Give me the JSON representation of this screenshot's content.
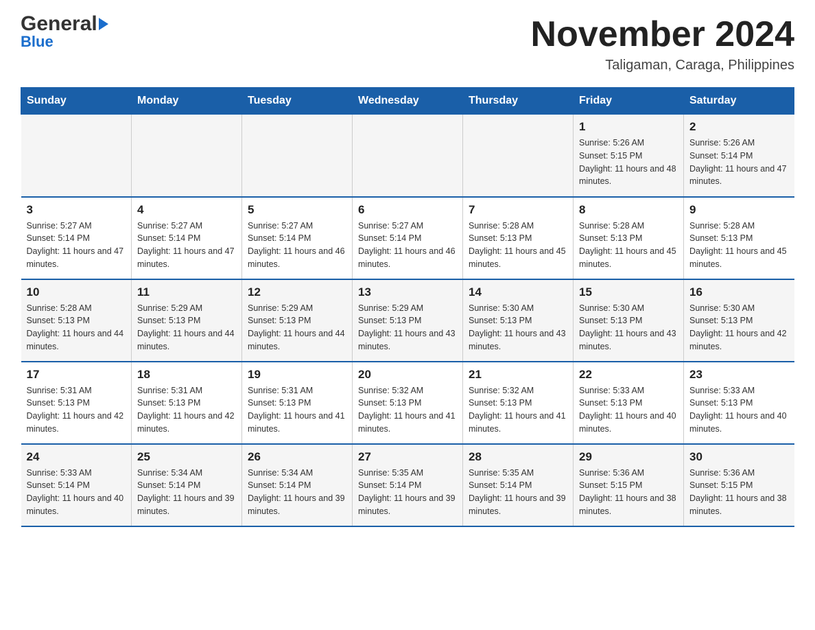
{
  "logo": {
    "general": "General",
    "blue": "Blue",
    "alt": "GeneralBlue logo"
  },
  "title": {
    "month": "November 2024",
    "location": "Taligaman, Caraga, Philippines"
  },
  "headers": [
    "Sunday",
    "Monday",
    "Tuesday",
    "Wednesday",
    "Thursday",
    "Friday",
    "Saturday"
  ],
  "weeks": [
    [
      {
        "day": "",
        "info": ""
      },
      {
        "day": "",
        "info": ""
      },
      {
        "day": "",
        "info": ""
      },
      {
        "day": "",
        "info": ""
      },
      {
        "day": "",
        "info": ""
      },
      {
        "day": "1",
        "info": "Sunrise: 5:26 AM\nSunset: 5:15 PM\nDaylight: 11 hours and 48 minutes."
      },
      {
        "day": "2",
        "info": "Sunrise: 5:26 AM\nSunset: 5:14 PM\nDaylight: 11 hours and 47 minutes."
      }
    ],
    [
      {
        "day": "3",
        "info": "Sunrise: 5:27 AM\nSunset: 5:14 PM\nDaylight: 11 hours and 47 minutes."
      },
      {
        "day": "4",
        "info": "Sunrise: 5:27 AM\nSunset: 5:14 PM\nDaylight: 11 hours and 47 minutes."
      },
      {
        "day": "5",
        "info": "Sunrise: 5:27 AM\nSunset: 5:14 PM\nDaylight: 11 hours and 46 minutes."
      },
      {
        "day": "6",
        "info": "Sunrise: 5:27 AM\nSunset: 5:14 PM\nDaylight: 11 hours and 46 minutes."
      },
      {
        "day": "7",
        "info": "Sunrise: 5:28 AM\nSunset: 5:13 PM\nDaylight: 11 hours and 45 minutes."
      },
      {
        "day": "8",
        "info": "Sunrise: 5:28 AM\nSunset: 5:13 PM\nDaylight: 11 hours and 45 minutes."
      },
      {
        "day": "9",
        "info": "Sunrise: 5:28 AM\nSunset: 5:13 PM\nDaylight: 11 hours and 45 minutes."
      }
    ],
    [
      {
        "day": "10",
        "info": "Sunrise: 5:28 AM\nSunset: 5:13 PM\nDaylight: 11 hours and 44 minutes."
      },
      {
        "day": "11",
        "info": "Sunrise: 5:29 AM\nSunset: 5:13 PM\nDaylight: 11 hours and 44 minutes."
      },
      {
        "day": "12",
        "info": "Sunrise: 5:29 AM\nSunset: 5:13 PM\nDaylight: 11 hours and 44 minutes."
      },
      {
        "day": "13",
        "info": "Sunrise: 5:29 AM\nSunset: 5:13 PM\nDaylight: 11 hours and 43 minutes."
      },
      {
        "day": "14",
        "info": "Sunrise: 5:30 AM\nSunset: 5:13 PM\nDaylight: 11 hours and 43 minutes."
      },
      {
        "day": "15",
        "info": "Sunrise: 5:30 AM\nSunset: 5:13 PM\nDaylight: 11 hours and 43 minutes."
      },
      {
        "day": "16",
        "info": "Sunrise: 5:30 AM\nSunset: 5:13 PM\nDaylight: 11 hours and 42 minutes."
      }
    ],
    [
      {
        "day": "17",
        "info": "Sunrise: 5:31 AM\nSunset: 5:13 PM\nDaylight: 11 hours and 42 minutes."
      },
      {
        "day": "18",
        "info": "Sunrise: 5:31 AM\nSunset: 5:13 PM\nDaylight: 11 hours and 42 minutes."
      },
      {
        "day": "19",
        "info": "Sunrise: 5:31 AM\nSunset: 5:13 PM\nDaylight: 11 hours and 41 minutes."
      },
      {
        "day": "20",
        "info": "Sunrise: 5:32 AM\nSunset: 5:13 PM\nDaylight: 11 hours and 41 minutes."
      },
      {
        "day": "21",
        "info": "Sunrise: 5:32 AM\nSunset: 5:13 PM\nDaylight: 11 hours and 41 minutes."
      },
      {
        "day": "22",
        "info": "Sunrise: 5:33 AM\nSunset: 5:13 PM\nDaylight: 11 hours and 40 minutes."
      },
      {
        "day": "23",
        "info": "Sunrise: 5:33 AM\nSunset: 5:13 PM\nDaylight: 11 hours and 40 minutes."
      }
    ],
    [
      {
        "day": "24",
        "info": "Sunrise: 5:33 AM\nSunset: 5:14 PM\nDaylight: 11 hours and 40 minutes."
      },
      {
        "day": "25",
        "info": "Sunrise: 5:34 AM\nSunset: 5:14 PM\nDaylight: 11 hours and 39 minutes."
      },
      {
        "day": "26",
        "info": "Sunrise: 5:34 AM\nSunset: 5:14 PM\nDaylight: 11 hours and 39 minutes."
      },
      {
        "day": "27",
        "info": "Sunrise: 5:35 AM\nSunset: 5:14 PM\nDaylight: 11 hours and 39 minutes."
      },
      {
        "day": "28",
        "info": "Sunrise: 5:35 AM\nSunset: 5:14 PM\nDaylight: 11 hours and 39 minutes."
      },
      {
        "day": "29",
        "info": "Sunrise: 5:36 AM\nSunset: 5:15 PM\nDaylight: 11 hours and 38 minutes."
      },
      {
        "day": "30",
        "info": "Sunrise: 5:36 AM\nSunset: 5:15 PM\nDaylight: 11 hours and 38 minutes."
      }
    ]
  ]
}
